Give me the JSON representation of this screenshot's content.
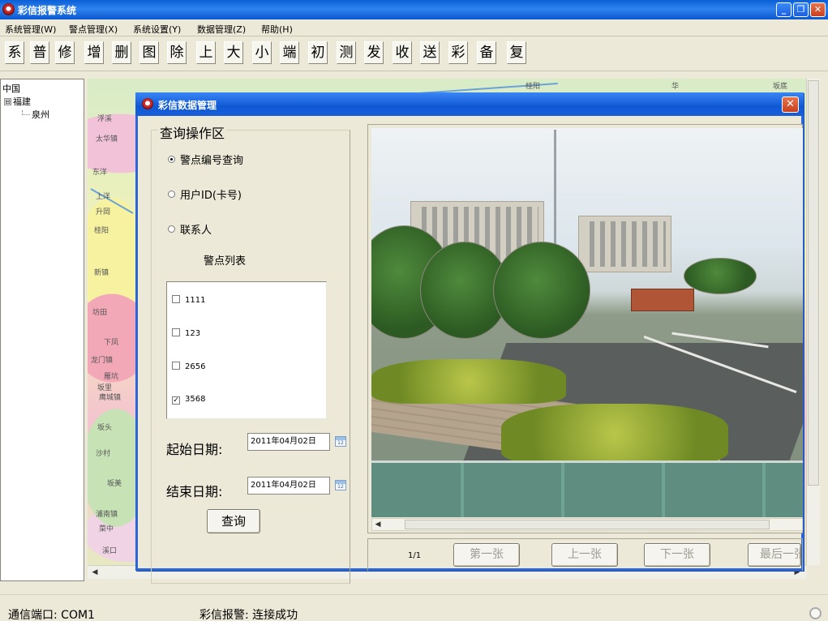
{
  "window": {
    "title": "彩信报警系统"
  },
  "menu": [
    "系统管理(W)",
    "警点管理(X)",
    "系统设置(Y)",
    "数据管理(Z)",
    "帮助(H)"
  ],
  "toolbar": [
    "系",
    "普",
    "修",
    "增",
    "删",
    "图",
    "除",
    "上",
    "大",
    "小",
    "端",
    "初",
    "测",
    "发",
    "收",
    "送",
    "彩",
    "备",
    "复"
  ],
  "tree": {
    "root": "中国",
    "province": "福建",
    "toggle": "⊟",
    "city": "泉州"
  },
  "map": {
    "labels": [
      "浮溪",
      "太华镇",
      "东洋",
      "上洋",
      "升岡",
      "桂阳",
      "新镇",
      "坊田",
      "下凤",
      "龙门镇",
      "雁坑",
      "坂里",
      "鹰城镇",
      "坂头",
      "沙村",
      "坂美",
      "浦南镇",
      "菜中",
      "溪口",
      "桂阳",
      "华",
      "坂底"
    ]
  },
  "dialog": {
    "title": "彩信数据管理",
    "close": "✕",
    "group_title": "查询操作区",
    "radios": [
      {
        "label": "警点编号查询",
        "checked": true
      },
      {
        "label": "用户ID(卡号)",
        "checked": false
      },
      {
        "label": "联系人",
        "checked": false
      }
    ],
    "list_label": "警点列表",
    "list_items": [
      {
        "label": "1111",
        "checked": false
      },
      {
        "label": "123",
        "checked": false
      },
      {
        "label": "2656",
        "checked": false
      },
      {
        "label": "3568",
        "checked": true
      }
    ],
    "check_mark": "✓",
    "start_date_label": "起始日期:",
    "start_date": "2011年04月02日",
    "end_date_label": "结束日期:",
    "end_date": "2011年04月02日",
    "cal_text": "12",
    "query_button": "查询",
    "page_indicator": "1/1",
    "first_button": "第一张",
    "prev_button": "上一张",
    "next_button": "下一张",
    "last_button": "最后一张"
  },
  "statusbar": {
    "port": "通信端口: COM1",
    "alarm": "彩信报警: 连接成功"
  },
  "colors": {
    "title_bar": "#0a5fd6",
    "close_button": "#c8401f"
  }
}
